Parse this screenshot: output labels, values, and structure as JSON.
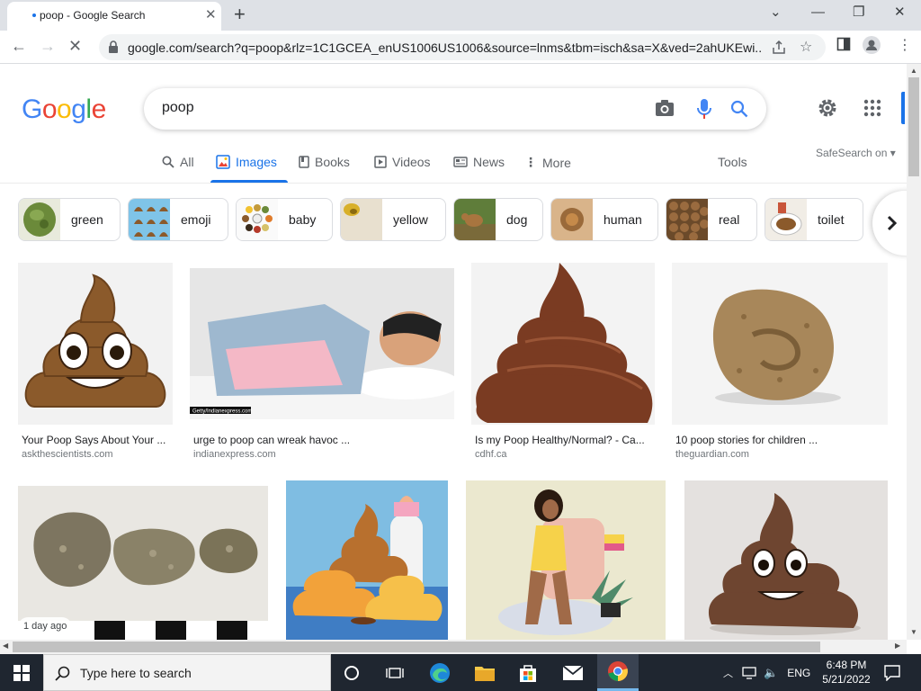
{
  "browser": {
    "tab_title": "poop - Google Search",
    "url": "google.com/search?q=poop&rlz=1C1GCEA_enUS1006US1006&source=lnms&tbm=isch&sa=X&ved=2ahUKEwi..."
  },
  "google": {
    "logo": [
      "G",
      "o",
      "o",
      "g",
      "l",
      "e"
    ],
    "logo_colors": [
      "#4285F4",
      "#EA4335",
      "#FBBC05",
      "#4285F4",
      "#34A853",
      "#EA4335"
    ],
    "query": "poop",
    "tabs": [
      {
        "label": "All",
        "icon": "search-icon"
      },
      {
        "label": "Images",
        "icon": "image-icon",
        "active": true
      },
      {
        "label": "Books",
        "icon": "book-icon"
      },
      {
        "label": "Videos",
        "icon": "play-icon"
      },
      {
        "label": "News",
        "icon": "news-icon"
      },
      {
        "label": "More",
        "icon": "more-vert-icon"
      }
    ],
    "tools_label": "Tools",
    "safesearch_label": "SafeSearch on"
  },
  "chips": [
    {
      "label": "green"
    },
    {
      "label": "emoji"
    },
    {
      "label": "baby"
    },
    {
      "label": "yellow"
    },
    {
      "label": "dog"
    },
    {
      "label": "human"
    },
    {
      "label": "real"
    },
    {
      "label": "toilet"
    }
  ],
  "results": [
    {
      "caption": "Your Poop Says About Your ...",
      "source": "askthescientists.com"
    },
    {
      "caption": "urge to poop can wreak havoc ...",
      "source": "indianexpress.com",
      "credit": "Getty/Indianexpress.com"
    },
    {
      "caption": "Is my Poop Healthy/Normal? - Ca...",
      "source": "cdhf.ca"
    },
    {
      "caption": "10 poop stories for children ...",
      "source": "theguardian.com"
    }
  ],
  "second_row_badge": "1 day ago",
  "taskbar": {
    "search_placeholder": "Type here to search",
    "language": "ENG",
    "time": "6:48 PM",
    "date": "5/21/2022"
  },
  "colors": {
    "accent": "#1a73e8",
    "poop_brown": "#8b5a2b",
    "taskbar": "#1f2630"
  }
}
